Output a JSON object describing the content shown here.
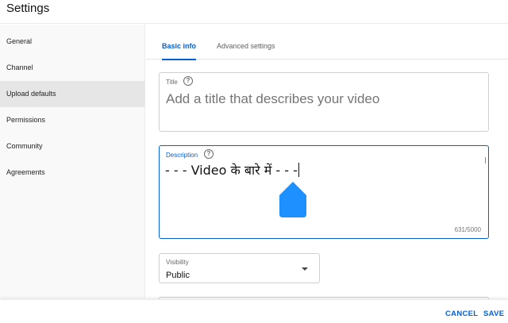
{
  "header": {
    "title": "Settings"
  },
  "sidebar": {
    "items": [
      {
        "label": "General",
        "active": false
      },
      {
        "label": "Channel",
        "active": false
      },
      {
        "label": "Upload defaults",
        "active": true
      },
      {
        "label": "Permissions",
        "active": false
      },
      {
        "label": "Community",
        "active": false
      },
      {
        "label": "Agreements",
        "active": false
      }
    ]
  },
  "tabs": [
    {
      "label": "Basic info",
      "active": true
    },
    {
      "label": "Advanced settings",
      "active": false
    }
  ],
  "form": {
    "title": {
      "label": "Title",
      "value": "",
      "placeholder": "Add a title that describes your video",
      "help_icon": "help-circle-icon"
    },
    "description": {
      "label": "Description",
      "value": "- - - Video के बारे में - - -",
      "counter": "631/5000",
      "help_icon": "help-circle-icon"
    },
    "visibility": {
      "label": "Visibility",
      "value": "Public",
      "icon": "chevron-down-icon"
    }
  },
  "footer": {
    "cancel_label": "CANCEL",
    "save_label": "SAVE"
  },
  "colors": {
    "accent": "#065fd4",
    "handle": "#1e90ff",
    "active_nav_bg": "#e6e6e6"
  }
}
